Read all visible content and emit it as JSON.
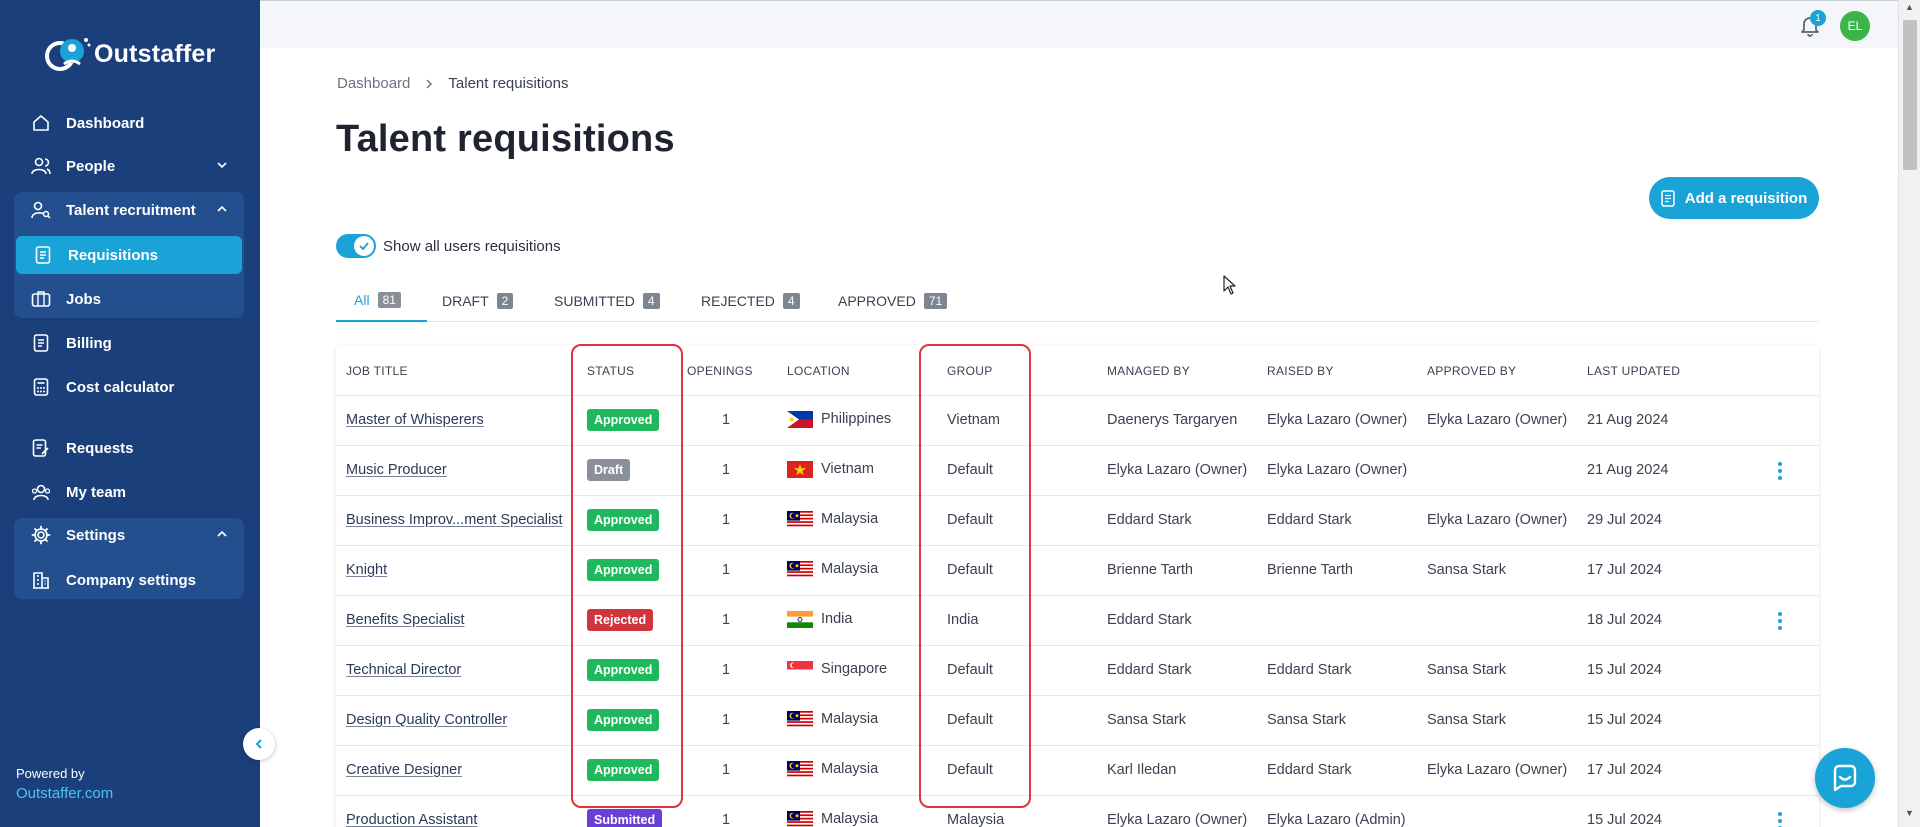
{
  "app": {
    "name": "Outstaffer"
  },
  "sidebar": {
    "items": [
      {
        "label": "Dashboard",
        "icon": "home-icon"
      },
      {
        "label": "People",
        "icon": "people-icon"
      },
      {
        "label": "Talent recruitment",
        "icon": "person-search-icon"
      },
      {
        "label": "Requisitions",
        "icon": "document-icon"
      },
      {
        "label": "Jobs",
        "icon": "briefcase-icon"
      },
      {
        "label": "Billing",
        "icon": "document-icon"
      },
      {
        "label": "Cost calculator",
        "icon": "calculator-icon"
      },
      {
        "label": "Requests",
        "icon": "document-edit-icon"
      },
      {
        "label": "My team",
        "icon": "team-icon"
      },
      {
        "label": "Settings",
        "icon": "gear-icon"
      },
      {
        "label": "Company settings",
        "icon": "building-icon"
      }
    ],
    "powered_by": "Powered by",
    "powered_link": "Outstaffer.com"
  },
  "topbar": {
    "notification_count": "1",
    "avatar_initials": "EL"
  },
  "breadcrumb": {
    "root": "Dashboard",
    "current": "Talent requisitions"
  },
  "page": {
    "title": "Talent requisitions",
    "add_button": "Add a requisition",
    "toggle_label": "Show all users requisitions"
  },
  "tabs": [
    {
      "label": "All",
      "count": "81"
    },
    {
      "label": "DRAFT",
      "count": "2"
    },
    {
      "label": "SUBMITTED",
      "count": "4"
    },
    {
      "label": "REJECTED",
      "count": "4"
    },
    {
      "label": "APPROVED",
      "count": "71"
    }
  ],
  "table": {
    "headers": {
      "job_title": "JOB TITLE",
      "status": "STATUS",
      "openings": "OPENINGS",
      "location": "LOCATION",
      "group": "GROUP",
      "managed_by": "MANAGED BY",
      "raised_by": "RAISED BY",
      "approved_by": "APPROVED BY",
      "last_updated": "LAST UPDATED"
    },
    "rows": [
      {
        "job": "Master of Whisperers",
        "status": "Approved",
        "openings": "1",
        "location": "Philippines",
        "flag": "ph",
        "group": "Vietnam",
        "managed": "Daenerys Targaryen",
        "raised": "Elyka Lazaro (Owner)",
        "approved": "Elyka Lazaro (Owner)",
        "updated": "21 Aug 2024",
        "menu": false
      },
      {
        "job": "Music Producer",
        "status": "Draft",
        "openings": "1",
        "location": "Vietnam",
        "flag": "vn",
        "group": "Default",
        "managed": "Elyka Lazaro (Owner)",
        "raised": "Elyka Lazaro (Owner)",
        "approved": "",
        "updated": "21 Aug 2024",
        "menu": true
      },
      {
        "job": "Business Improv...ment Specialist",
        "status": "Approved",
        "openings": "1",
        "location": "Malaysia",
        "flag": "my",
        "group": "Default",
        "managed": "Eddard Stark",
        "raised": "Eddard Stark",
        "approved": "Elyka Lazaro (Owner)",
        "updated": "29 Jul 2024",
        "menu": false
      },
      {
        "job": "Knight",
        "status": "Approved",
        "openings": "1",
        "location": "Malaysia",
        "flag": "my",
        "group": "Default",
        "managed": "Brienne Tarth",
        "raised": "Brienne Tarth",
        "approved": "Sansa Stark",
        "updated": "17 Jul 2024",
        "menu": false
      },
      {
        "job": "Benefits Specialist",
        "status": "Rejected",
        "openings": "1",
        "location": "India",
        "flag": "in",
        "group": "India",
        "managed": "Eddard Stark",
        "raised": "",
        "approved": "",
        "updated": "18 Jul 2024",
        "menu": true
      },
      {
        "job": "Technical Director",
        "status": "Approved",
        "openings": "1",
        "location": "Singapore",
        "flag": "sg",
        "group": "Default",
        "managed": "Eddard Stark",
        "raised": "Eddard Stark",
        "approved": "Sansa Stark",
        "updated": "15 Jul 2024",
        "menu": false
      },
      {
        "job": "Design Quality Controller",
        "status": "Approved",
        "openings": "1",
        "location": "Malaysia",
        "flag": "my",
        "group": "Default",
        "managed": "Sansa Stark",
        "raised": "Sansa Stark",
        "approved": "Sansa Stark",
        "updated": "15 Jul 2024",
        "menu": false
      },
      {
        "job": "Creative Designer",
        "status": "Approved",
        "openings": "1",
        "location": "Malaysia",
        "flag": "my",
        "group": "Default",
        "managed": "Karl Iledan",
        "raised": "Eddard Stark",
        "approved": "Elyka Lazaro (Owner)",
        "updated": "17 Jul 2024",
        "menu": false
      },
      {
        "job": "Production Assistant",
        "status": "Submitted",
        "openings": "1",
        "location": "Malaysia",
        "flag": "my",
        "group": "Malaysia",
        "managed": "Elyka Lazaro (Owner)",
        "raised": "Elyka Lazaro (Admin)",
        "approved": "",
        "updated": "15 Jul 2024",
        "menu": true
      }
    ]
  },
  "colors": {
    "sidebar": "#1b3f7a",
    "accent": "#1aa3d6",
    "approved": "#1fb85c",
    "draft": "#8a9099",
    "rejected": "#d0343c",
    "submitted": "#6a3fd6",
    "highlight": "#e0333d"
  }
}
